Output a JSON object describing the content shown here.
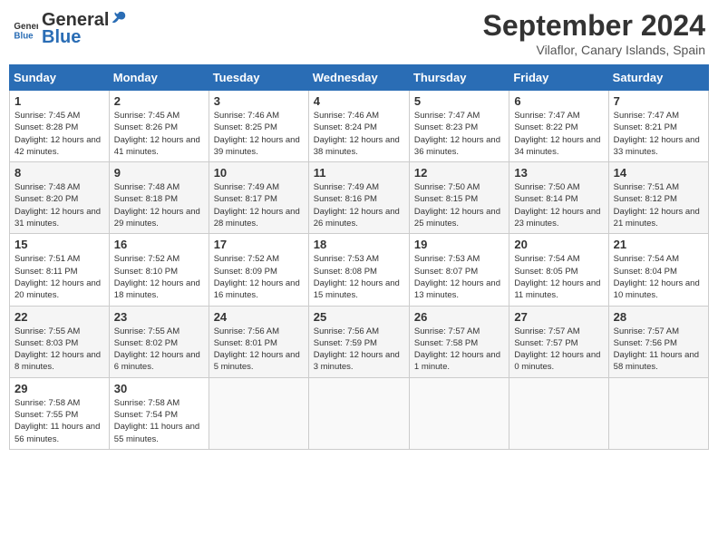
{
  "logo": {
    "line1": "General",
    "line2": "Blue"
  },
  "title": "September 2024",
  "location": "Vilaflor, Canary Islands, Spain",
  "days_of_week": [
    "Sunday",
    "Monday",
    "Tuesday",
    "Wednesday",
    "Thursday",
    "Friday",
    "Saturday"
  ],
  "weeks": [
    [
      {
        "day": "1",
        "sunrise": "Sunrise: 7:45 AM",
        "sunset": "Sunset: 8:28 PM",
        "daylight": "Daylight: 12 hours and 42 minutes."
      },
      {
        "day": "2",
        "sunrise": "Sunrise: 7:45 AM",
        "sunset": "Sunset: 8:26 PM",
        "daylight": "Daylight: 12 hours and 41 minutes."
      },
      {
        "day": "3",
        "sunrise": "Sunrise: 7:46 AM",
        "sunset": "Sunset: 8:25 PM",
        "daylight": "Daylight: 12 hours and 39 minutes."
      },
      {
        "day": "4",
        "sunrise": "Sunrise: 7:46 AM",
        "sunset": "Sunset: 8:24 PM",
        "daylight": "Daylight: 12 hours and 38 minutes."
      },
      {
        "day": "5",
        "sunrise": "Sunrise: 7:47 AM",
        "sunset": "Sunset: 8:23 PM",
        "daylight": "Daylight: 12 hours and 36 minutes."
      },
      {
        "day": "6",
        "sunrise": "Sunrise: 7:47 AM",
        "sunset": "Sunset: 8:22 PM",
        "daylight": "Daylight: 12 hours and 34 minutes."
      },
      {
        "day": "7",
        "sunrise": "Sunrise: 7:47 AM",
        "sunset": "Sunset: 8:21 PM",
        "daylight": "Daylight: 12 hours and 33 minutes."
      }
    ],
    [
      {
        "day": "8",
        "sunrise": "Sunrise: 7:48 AM",
        "sunset": "Sunset: 8:20 PM",
        "daylight": "Daylight: 12 hours and 31 minutes."
      },
      {
        "day": "9",
        "sunrise": "Sunrise: 7:48 AM",
        "sunset": "Sunset: 8:18 PM",
        "daylight": "Daylight: 12 hours and 29 minutes."
      },
      {
        "day": "10",
        "sunrise": "Sunrise: 7:49 AM",
        "sunset": "Sunset: 8:17 PM",
        "daylight": "Daylight: 12 hours and 28 minutes."
      },
      {
        "day": "11",
        "sunrise": "Sunrise: 7:49 AM",
        "sunset": "Sunset: 8:16 PM",
        "daylight": "Daylight: 12 hours and 26 minutes."
      },
      {
        "day": "12",
        "sunrise": "Sunrise: 7:50 AM",
        "sunset": "Sunset: 8:15 PM",
        "daylight": "Daylight: 12 hours and 25 minutes."
      },
      {
        "day": "13",
        "sunrise": "Sunrise: 7:50 AM",
        "sunset": "Sunset: 8:14 PM",
        "daylight": "Daylight: 12 hours and 23 minutes."
      },
      {
        "day": "14",
        "sunrise": "Sunrise: 7:51 AM",
        "sunset": "Sunset: 8:12 PM",
        "daylight": "Daylight: 12 hours and 21 minutes."
      }
    ],
    [
      {
        "day": "15",
        "sunrise": "Sunrise: 7:51 AM",
        "sunset": "Sunset: 8:11 PM",
        "daylight": "Daylight: 12 hours and 20 minutes."
      },
      {
        "day": "16",
        "sunrise": "Sunrise: 7:52 AM",
        "sunset": "Sunset: 8:10 PM",
        "daylight": "Daylight: 12 hours and 18 minutes."
      },
      {
        "day": "17",
        "sunrise": "Sunrise: 7:52 AM",
        "sunset": "Sunset: 8:09 PM",
        "daylight": "Daylight: 12 hours and 16 minutes."
      },
      {
        "day": "18",
        "sunrise": "Sunrise: 7:53 AM",
        "sunset": "Sunset: 8:08 PM",
        "daylight": "Daylight: 12 hours and 15 minutes."
      },
      {
        "day": "19",
        "sunrise": "Sunrise: 7:53 AM",
        "sunset": "Sunset: 8:07 PM",
        "daylight": "Daylight: 12 hours and 13 minutes."
      },
      {
        "day": "20",
        "sunrise": "Sunrise: 7:54 AM",
        "sunset": "Sunset: 8:05 PM",
        "daylight": "Daylight: 12 hours and 11 minutes."
      },
      {
        "day": "21",
        "sunrise": "Sunrise: 7:54 AM",
        "sunset": "Sunset: 8:04 PM",
        "daylight": "Daylight: 12 hours and 10 minutes."
      }
    ],
    [
      {
        "day": "22",
        "sunrise": "Sunrise: 7:55 AM",
        "sunset": "Sunset: 8:03 PM",
        "daylight": "Daylight: 12 hours and 8 minutes."
      },
      {
        "day": "23",
        "sunrise": "Sunrise: 7:55 AM",
        "sunset": "Sunset: 8:02 PM",
        "daylight": "Daylight: 12 hours and 6 minutes."
      },
      {
        "day": "24",
        "sunrise": "Sunrise: 7:56 AM",
        "sunset": "Sunset: 8:01 PM",
        "daylight": "Daylight: 12 hours and 5 minutes."
      },
      {
        "day": "25",
        "sunrise": "Sunrise: 7:56 AM",
        "sunset": "Sunset: 7:59 PM",
        "daylight": "Daylight: 12 hours and 3 minutes."
      },
      {
        "day": "26",
        "sunrise": "Sunrise: 7:57 AM",
        "sunset": "Sunset: 7:58 PM",
        "daylight": "Daylight: 12 hours and 1 minute."
      },
      {
        "day": "27",
        "sunrise": "Sunrise: 7:57 AM",
        "sunset": "Sunset: 7:57 PM",
        "daylight": "Daylight: 12 hours and 0 minutes."
      },
      {
        "day": "28",
        "sunrise": "Sunrise: 7:57 AM",
        "sunset": "Sunset: 7:56 PM",
        "daylight": "Daylight: 11 hours and 58 minutes."
      }
    ],
    [
      {
        "day": "29",
        "sunrise": "Sunrise: 7:58 AM",
        "sunset": "Sunset: 7:55 PM",
        "daylight": "Daylight: 11 hours and 56 minutes."
      },
      {
        "day": "30",
        "sunrise": "Sunrise: 7:58 AM",
        "sunset": "Sunset: 7:54 PM",
        "daylight": "Daylight: 11 hours and 55 minutes."
      },
      null,
      null,
      null,
      null,
      null
    ]
  ]
}
